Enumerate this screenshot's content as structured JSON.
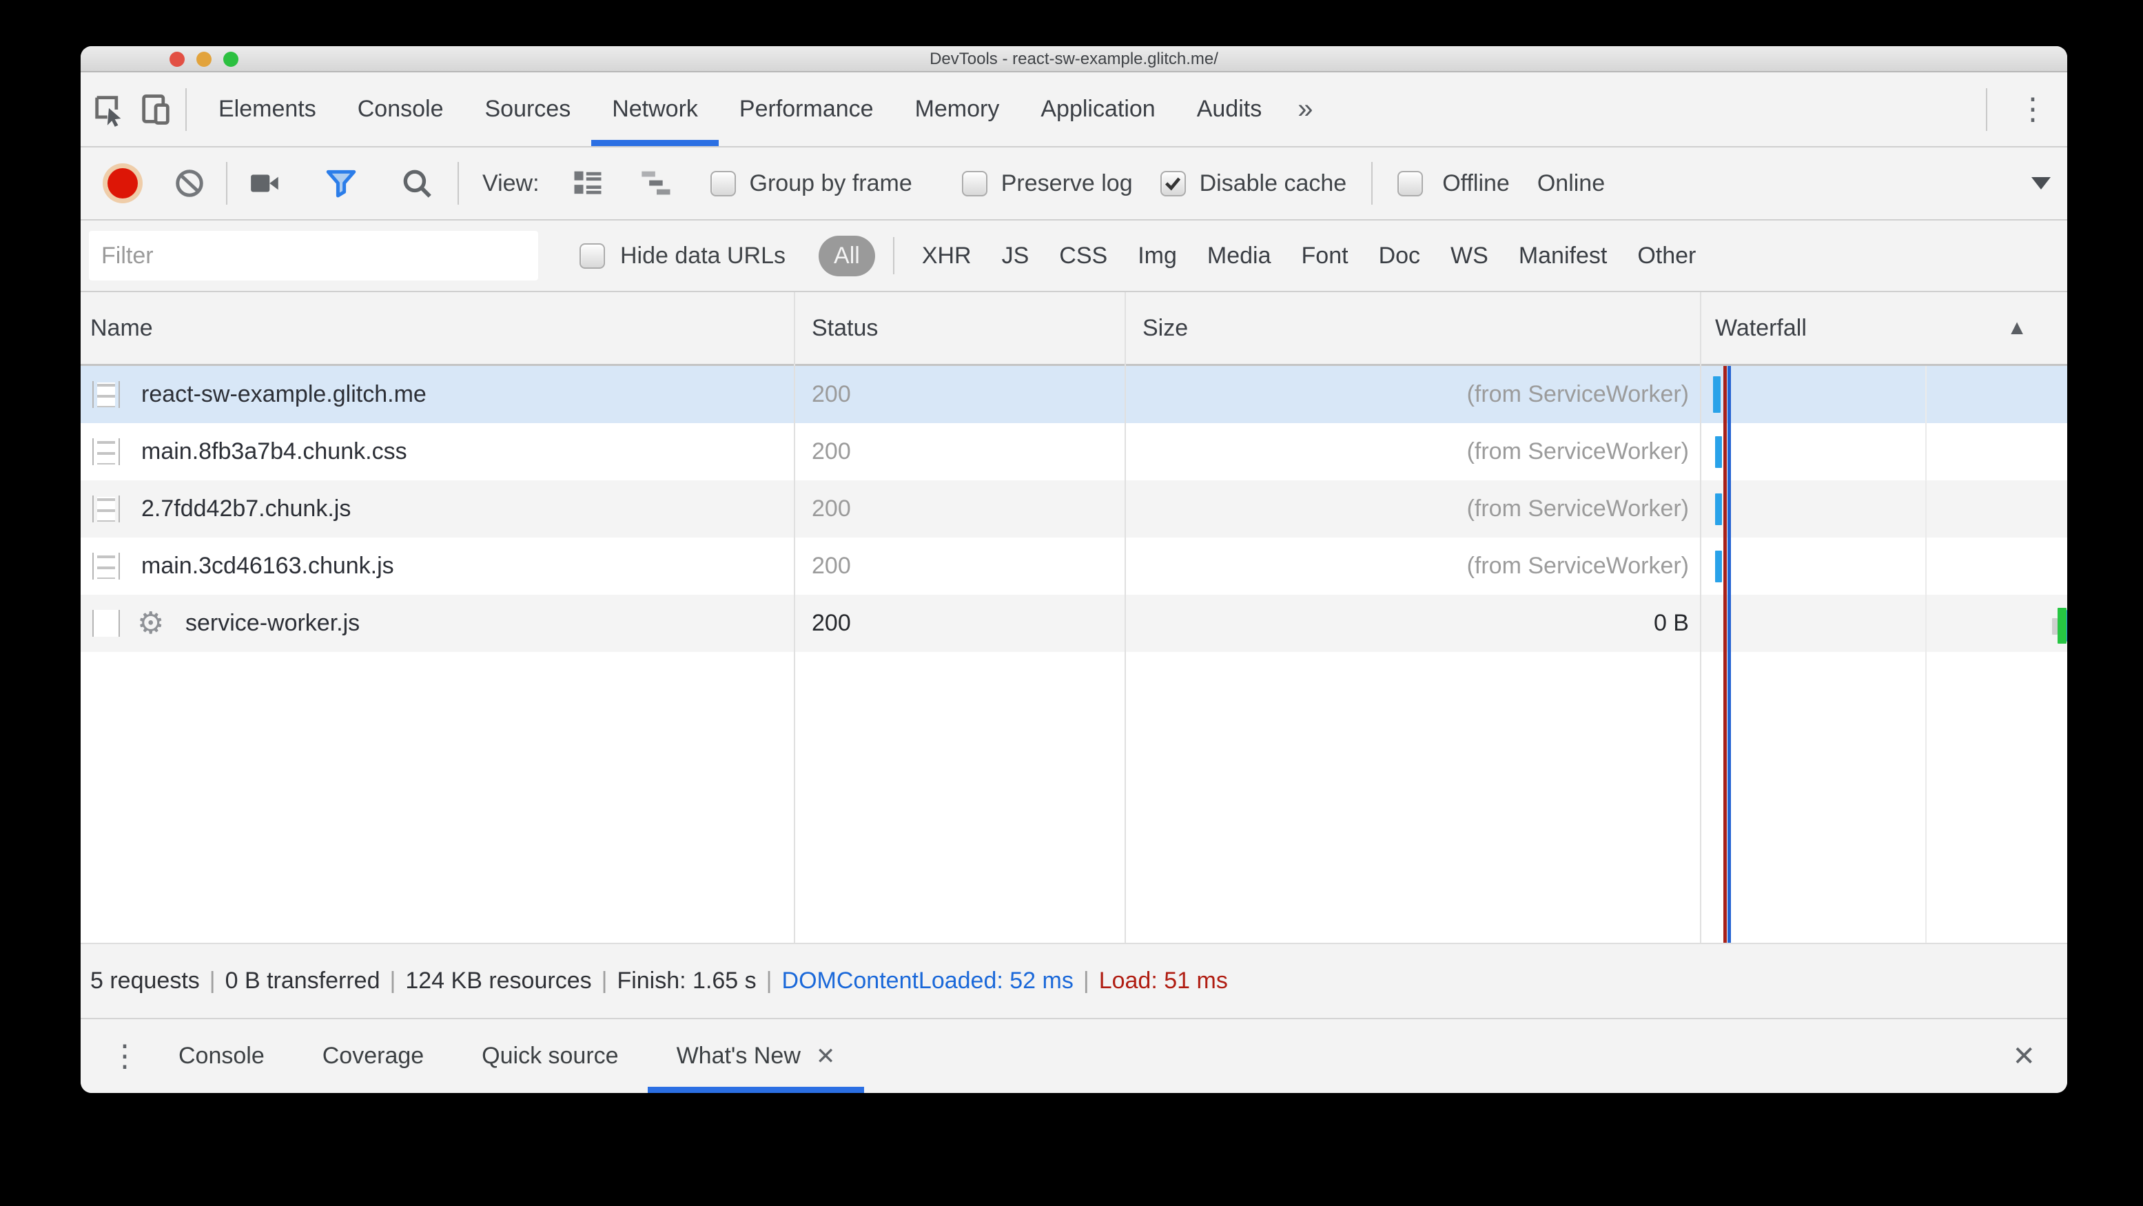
{
  "window": {
    "title": "DevTools - react-sw-example.glitch.me/"
  },
  "icons": {
    "chevrons": "»",
    "kebab": "⋮",
    "close": "✕",
    "gear": "⚙",
    "sort_asc": "▲",
    "separator_pipe": "|"
  },
  "tabs": [
    "Elements",
    "Console",
    "Sources",
    "Network",
    "Performance",
    "Memory",
    "Application",
    "Audits"
  ],
  "toolbar": {
    "view_label": "View:",
    "group_by_frame": "Group by frame",
    "preserve_log": "Preserve log",
    "disable_cache": "Disable cache",
    "offline": "Offline",
    "online": "Online"
  },
  "filter_bar": {
    "placeholder": "Filter",
    "hide_data_urls": "Hide data URLs",
    "all": "All",
    "types": [
      "XHR",
      "JS",
      "CSS",
      "Img",
      "Media",
      "Font",
      "Doc",
      "WS",
      "Manifest",
      "Other"
    ]
  },
  "table": {
    "columns": [
      "Name",
      "Status",
      "Size",
      "Waterfall"
    ],
    "rows": [
      {
        "name": "react-sw-example.glitch.me",
        "status": "200",
        "size": "(from ServiceWorker)"
      },
      {
        "name": "main.8fb3a7b4.chunk.css",
        "status": "200",
        "size": "(from ServiceWorker)"
      },
      {
        "name": "2.7fdd42b7.chunk.js",
        "status": "200",
        "size": "(from ServiceWorker)"
      },
      {
        "name": "main.3cd46163.chunk.js",
        "status": "200",
        "size": "(from ServiceWorker)"
      },
      {
        "name": "service-worker.js",
        "status": "200",
        "size": "0 B"
      }
    ]
  },
  "summary": {
    "requests": "5 requests",
    "transferred": "0 B transferred",
    "resources": "124 KB resources",
    "finish": "Finish: 1.65 s",
    "dcl": "DOMContentLoaded: 52 ms",
    "load": "Load: 51 ms",
    "sep": "|"
  },
  "drawer": {
    "tabs": [
      "Console",
      "Coverage",
      "Quick source",
      "What's New"
    ]
  },
  "colors": {
    "accent_blue": "#2b6fe3",
    "dcl_blue": "#1a68d9",
    "load_red": "#b01d12",
    "waterfall_blue": "#29a2e9",
    "waterfall_green": "#27c643",
    "selected_row": "#d8e7f7",
    "record_red": "#dd1606"
  }
}
